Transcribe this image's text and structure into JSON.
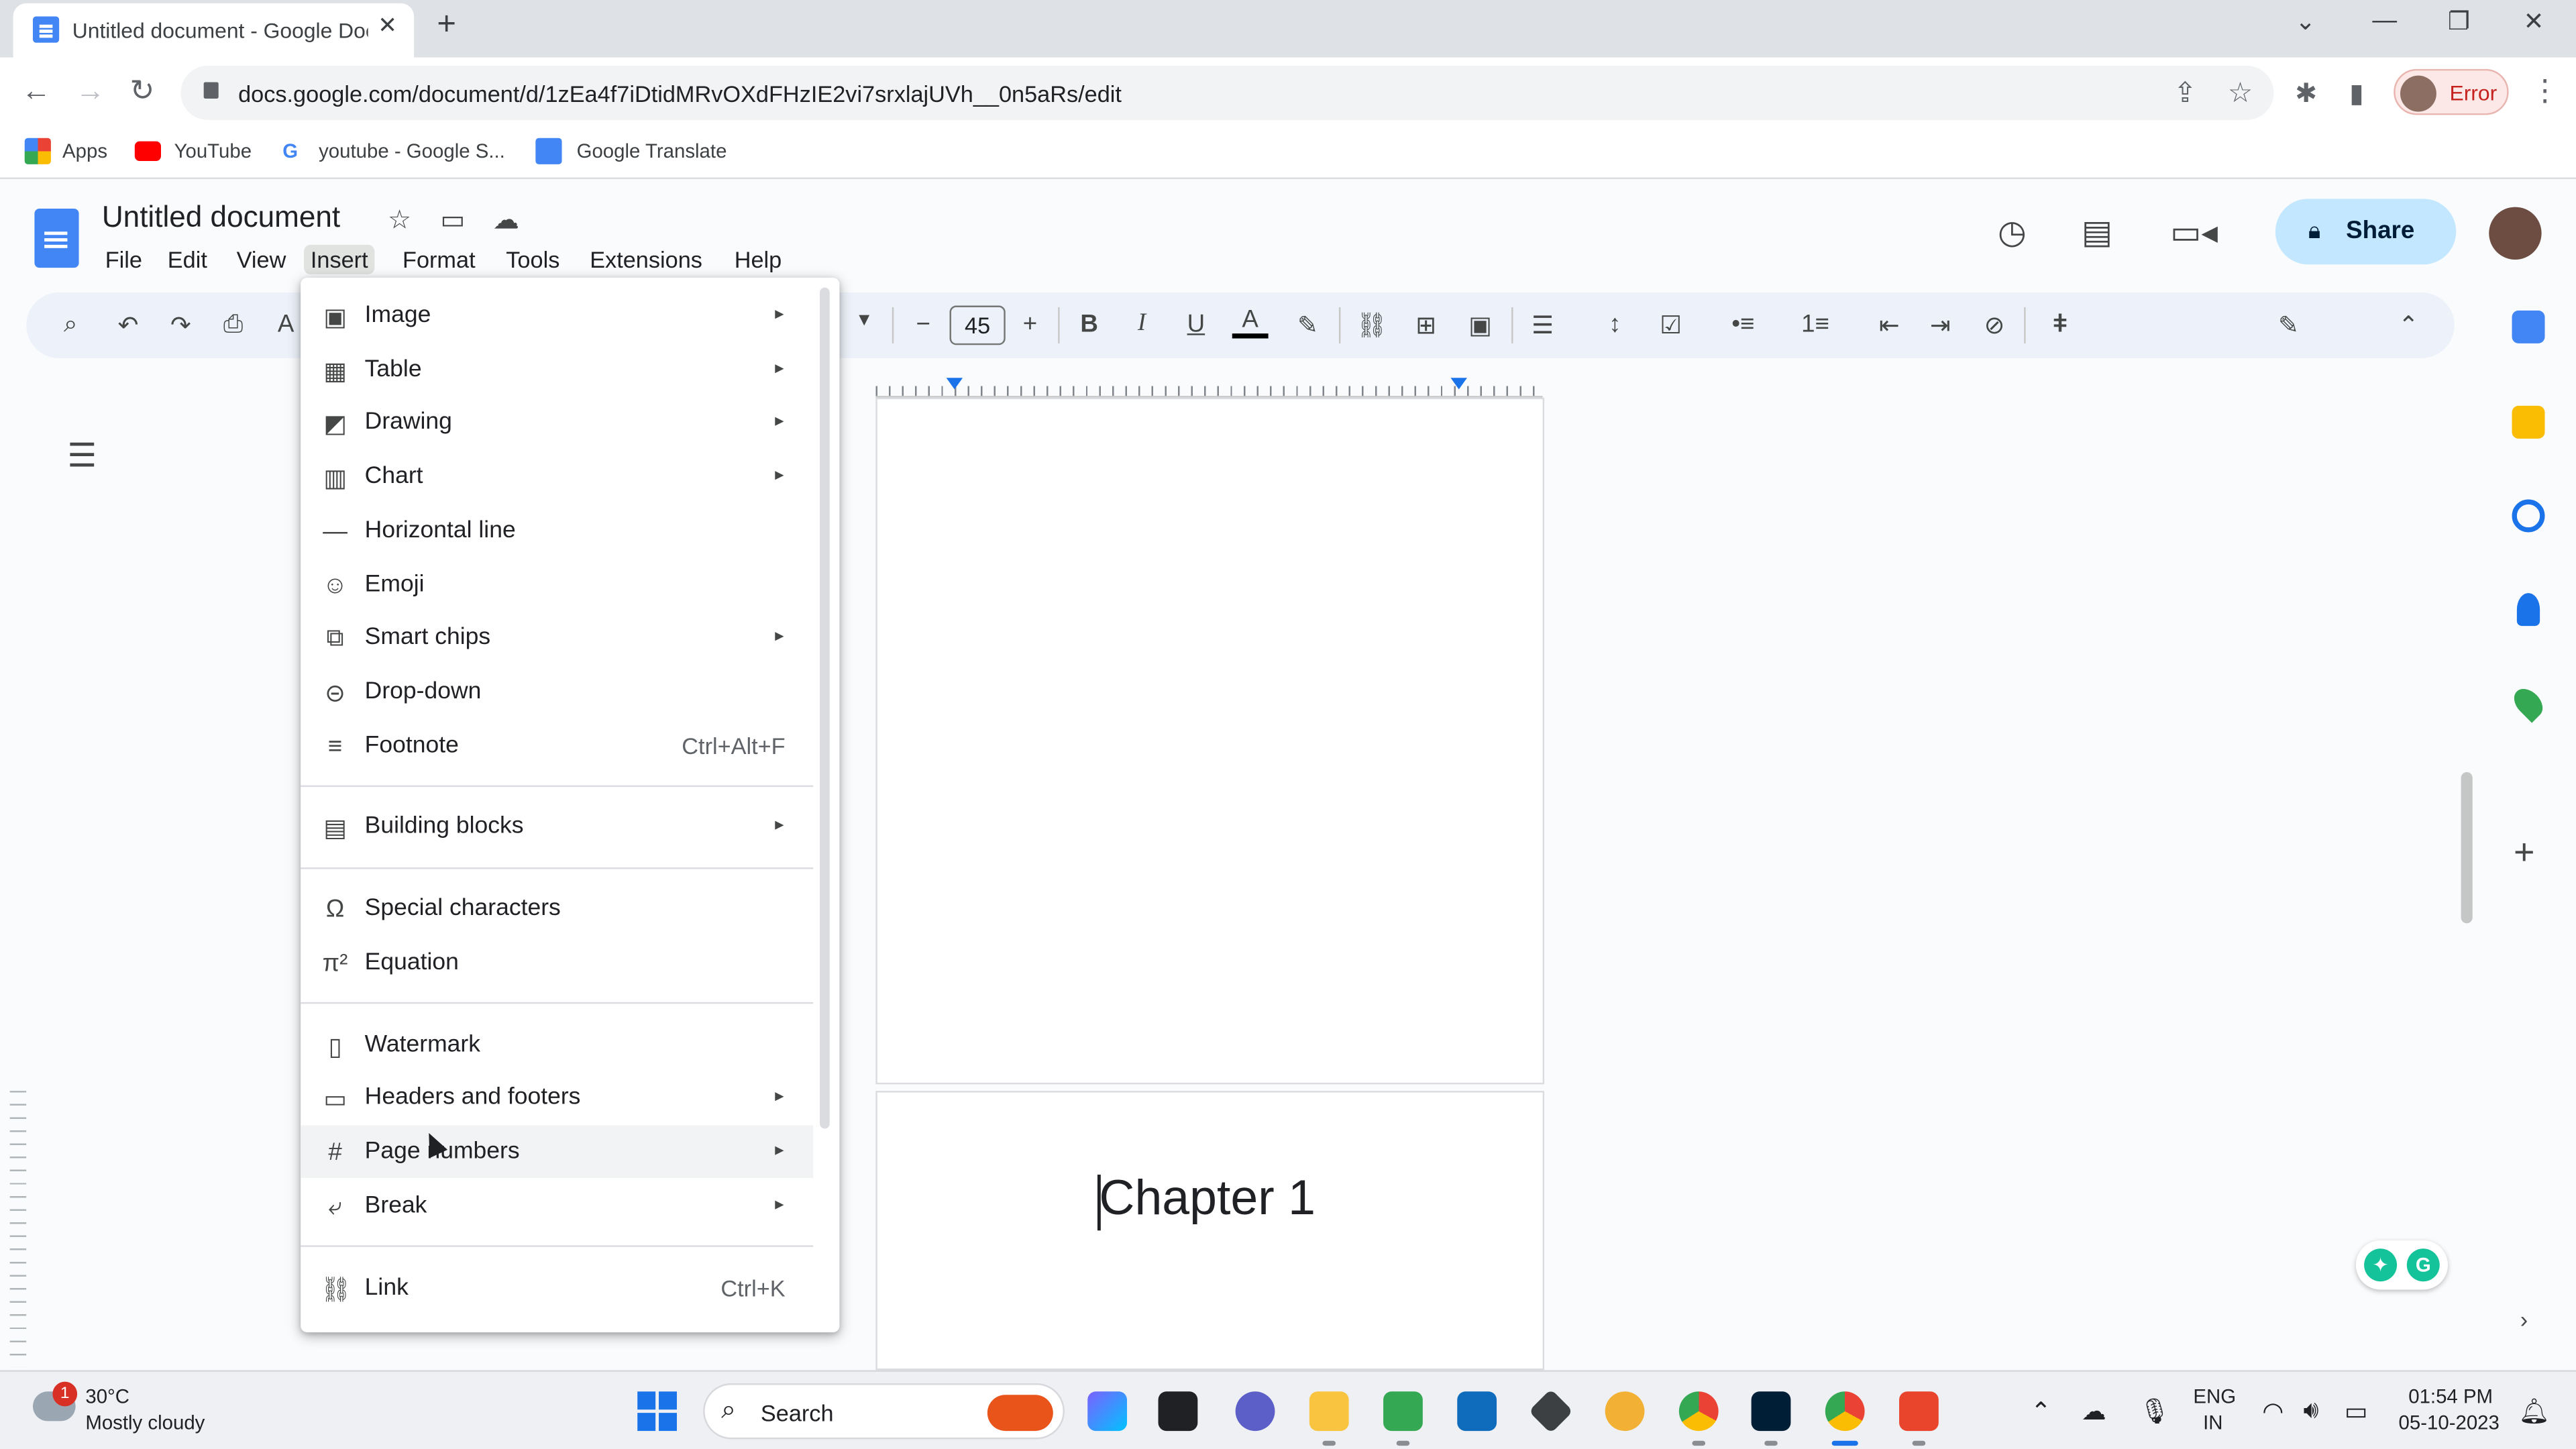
{
  "browser": {
    "tab_title": "Untitled document - Google Docs",
    "url": "docs.google.com/document/d/1zEa4f7iDtidMRvOXdFHzIE2vi7srxlajUVh__0n5aRs/edit",
    "profile_status": "Error",
    "bookmarks": [
      {
        "label": "Apps"
      },
      {
        "label": "YouTube"
      },
      {
        "label": "youtube - Google S..."
      },
      {
        "label": "Google Translate"
      }
    ]
  },
  "docs": {
    "title": "Untitled document",
    "menu": [
      "File",
      "Edit",
      "View",
      "Insert",
      "Format",
      "Tools",
      "Extensions",
      "Help"
    ],
    "active_menu": "Insert",
    "share_label": "Share",
    "font_size": "45",
    "page_text": "Chapter 1"
  },
  "insert_menu": {
    "items": [
      {
        "label": "Image",
        "icon": "image-icon",
        "submenu": true
      },
      {
        "label": "Table",
        "icon": "table-icon",
        "submenu": true
      },
      {
        "label": "Drawing",
        "icon": "drawing-icon",
        "submenu": true
      },
      {
        "label": "Chart",
        "icon": "chart-icon",
        "submenu": true
      },
      {
        "label": "Horizontal line",
        "icon": "horizontal-line-icon",
        "submenu": false
      },
      {
        "label": "Emoji",
        "icon": "emoji-icon",
        "submenu": false
      },
      {
        "label": "Smart chips",
        "icon": "smart-chips-icon",
        "submenu": true
      },
      {
        "label": "Drop-down",
        "icon": "dropdown-icon",
        "submenu": false
      },
      {
        "label": "Footnote",
        "icon": "footnote-icon",
        "submenu": false,
        "shortcut": "Ctrl+Alt+F"
      },
      {
        "label": "Building blocks",
        "icon": "building-blocks-icon",
        "submenu": true
      },
      {
        "label": "Special characters",
        "icon": "omega-icon",
        "submenu": false
      },
      {
        "label": "Equation",
        "icon": "pi-icon",
        "submenu": false
      },
      {
        "label": "Watermark",
        "icon": "watermark-icon",
        "submenu": false
      },
      {
        "label": "Headers and footers",
        "icon": "header-footer-icon",
        "submenu": true
      },
      {
        "label": "Page numbers",
        "icon": "hash-icon",
        "submenu": true,
        "hovered": true
      },
      {
        "label": "Break",
        "icon": "break-icon",
        "submenu": true
      },
      {
        "label": "Link",
        "icon": "link-icon",
        "submenu": false,
        "shortcut": "Ctrl+K"
      }
    ]
  },
  "taskbar": {
    "temperature": "30°C",
    "weather": "Mostly cloudy",
    "weather_alerts": "1",
    "search_label": "Search",
    "language": "ENG",
    "region": "IN",
    "time": "01:54 PM",
    "date": "05-10-2023"
  }
}
